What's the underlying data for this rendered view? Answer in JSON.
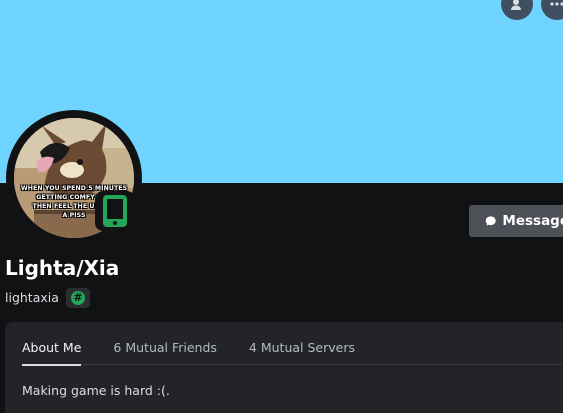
{
  "profile": {
    "display_name": "Lighta/Xia",
    "username": "lightaxia",
    "badge_symbol": "#",
    "about_text": "Making game is hard :(.",
    "status": "mobile-online",
    "avatar_caption": [
      "WHEN YOU SPEND 5 MINUTES",
      "GETTING COMFY IN B",
      "THEN FEEL THE URGE T",
      "A PISS"
    ]
  },
  "actions": {
    "message_label": "Message"
  },
  "tabs": [
    {
      "label": "About Me",
      "active": true
    },
    {
      "label": "6 Mutual Friends",
      "active": false
    },
    {
      "label": "4 Mutual Servers",
      "active": false
    }
  ],
  "top_buttons": [
    "add-friend-icon",
    "more-icon"
  ],
  "colors": {
    "banner": "#6fd4ff",
    "background": "#111214",
    "panel": "#232428",
    "status_green": "#23a55a",
    "button": "#4e5058"
  }
}
